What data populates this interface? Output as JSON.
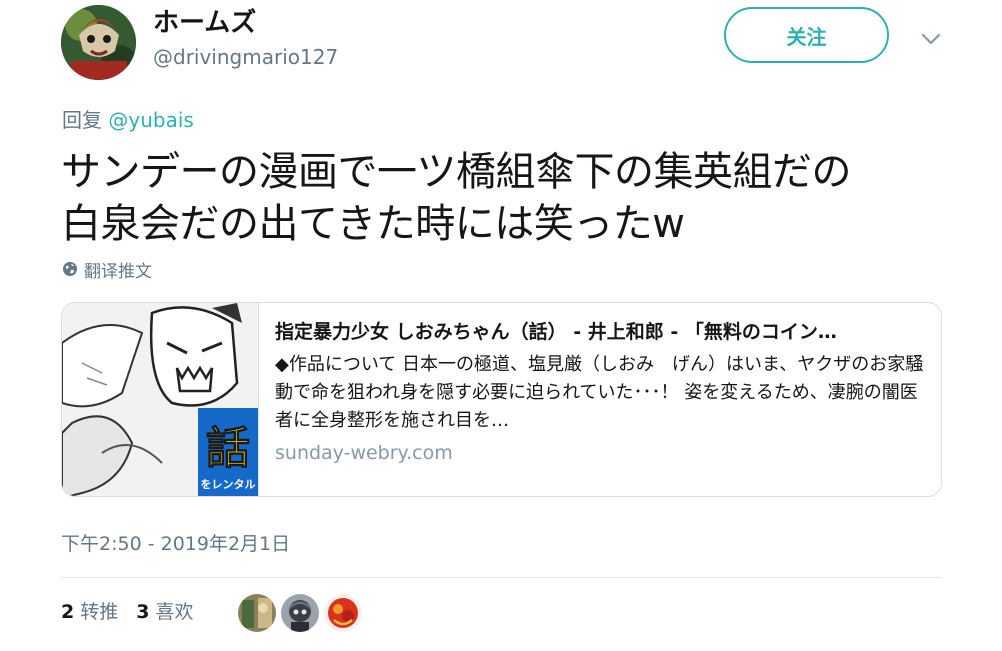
{
  "header": {
    "display_name": "ホームズ",
    "handle": "@drivingmario127",
    "follow_label": "关注"
  },
  "reply": {
    "prefix": "回复",
    "mention": "@yubais"
  },
  "tweet": {
    "line1": "サンデーの漫画で一ツ橋組傘下の集英組だの",
    "line2": "白泉会だの出てきた時には笑ったw",
    "translate_label": "翻译推文"
  },
  "card": {
    "title": "指定暴力少女 しおみちゃん（話） - 井上和郎 - 「無料のコイン…",
    "description": "◆作品について 日本一の極道、塩見厳（しおみ　げん）はいま、ヤクザのお家騒動で命を狙われ身を隠す必要に迫られていた･･･！ 姿を変えるため、凄腕の闇医者に全身整形を施され目を…",
    "domain": "sunday-webry.com",
    "image_badge_big": "話",
    "image_badge_small": "をレンタル"
  },
  "meta": {
    "timestamp": "下午2:50 - 2019年2月1日"
  },
  "stats": {
    "retweets_count": "2",
    "retweets_label": "转推",
    "likes_count": "3",
    "likes_label": "喜欢"
  },
  "icons": {
    "chevron": "chevron-down-icon",
    "globe": "globe-icon"
  },
  "colors": {
    "accent": "#2cb1b0",
    "secondary_text": "#657786",
    "border": "#d8dee3"
  }
}
